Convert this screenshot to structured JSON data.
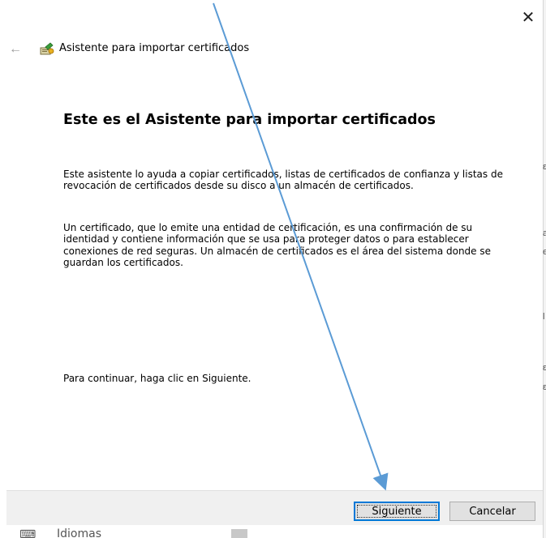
{
  "dialog": {
    "title": "Asistente para importar certificados",
    "heading": "Este es el Asistente para importar certificados",
    "paragraph1": "Este asistente lo ayuda a copiar certificados, listas de certificados de confianza y listas de revocación de certificados desde su disco a un almacén de certificados.",
    "paragraph2": "Un certificado, que lo emite una entidad de certificación, es una confirmación de su identidad y contiene información que se usa para proteger datos o para establecer conexiones de red seguras. Un almacén de certificados es el área del sistema donde se guardan los certificados.",
    "paragraph3": "Para continuar, haga clic en Siguiente.",
    "close_glyph": "✕",
    "back_glyph": "←",
    "buttons": {
      "next": "Siguiente",
      "cancel": "Cancelar"
    }
  },
  "background": {
    "item_label": "Idiomas"
  },
  "colors": {
    "accent": "#0078d7",
    "annotation_arrow": "#5b9bd5",
    "footer_bg": "#f0f0f0"
  },
  "icons": [
    "close-icon",
    "back-arrow-icon",
    "certificate-wizard-icon"
  ]
}
